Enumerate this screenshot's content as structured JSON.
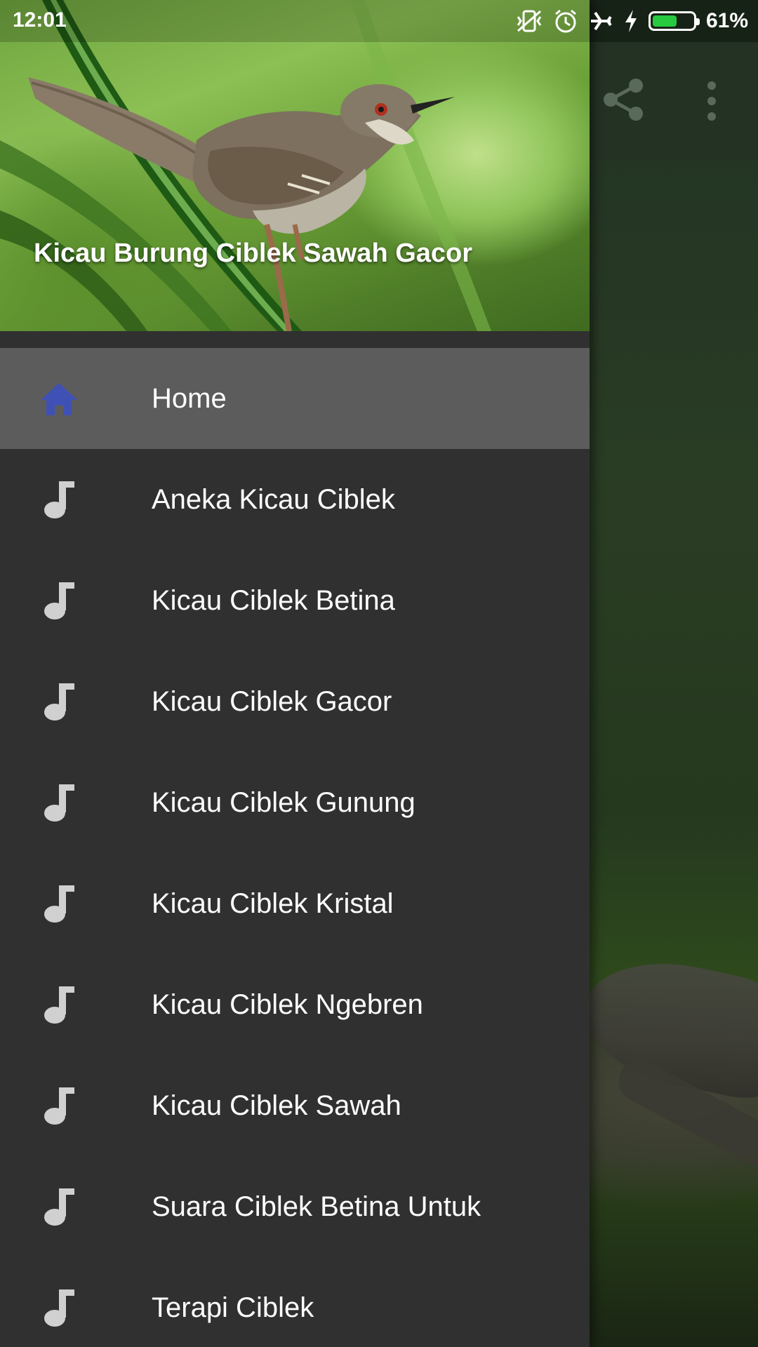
{
  "status_bar": {
    "time": "12:01",
    "battery_percent": "61%",
    "battery_level": 0.61,
    "icons": [
      "vibrate-off-icon",
      "alarm-icon",
      "airplane-mode-icon",
      "charging-bolt-icon",
      "battery-icon"
    ]
  },
  "background_app": {
    "toolbar_actions": [
      "share-icon",
      "more-vert-icon"
    ]
  },
  "drawer": {
    "header_title": "Kicau Burung Ciblek Sawah Gacor",
    "accent_color": "#3f51b5",
    "items": [
      {
        "label": "Home",
        "icon": "home-icon",
        "active": true
      },
      {
        "label": "Aneka Kicau Ciblek",
        "icon": "music-note-icon",
        "active": false
      },
      {
        "label": "Kicau Ciblek Betina",
        "icon": "music-note-icon",
        "active": false
      },
      {
        "label": "Kicau Ciblek Gacor",
        "icon": "music-note-icon",
        "active": false
      },
      {
        "label": "Kicau Ciblek Gunung",
        "icon": "music-note-icon",
        "active": false
      },
      {
        "label": "Kicau Ciblek Kristal",
        "icon": "music-note-icon",
        "active": false
      },
      {
        "label": "Kicau Ciblek Ngebren",
        "icon": "music-note-icon",
        "active": false
      },
      {
        "label": "Kicau Ciblek Sawah",
        "icon": "music-note-icon",
        "active": false
      },
      {
        "label": "Suara Ciblek Betina Untuk",
        "icon": "music-note-icon",
        "active": false
      },
      {
        "label": "Terapi Ciblek",
        "icon": "music-note-icon",
        "active": false
      }
    ]
  }
}
